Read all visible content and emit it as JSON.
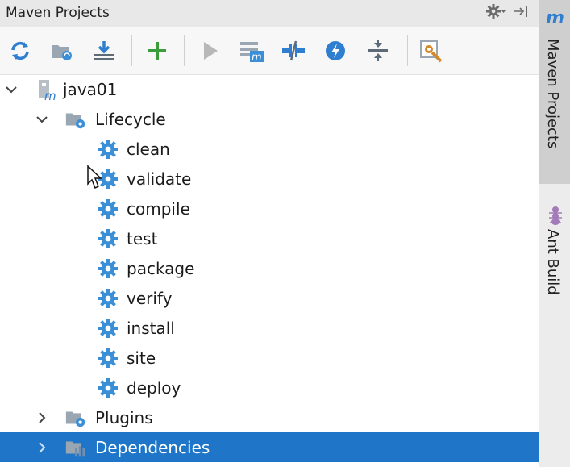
{
  "window": {
    "title": "Maven Projects"
  },
  "toolbar": {
    "items": [
      {
        "name": "reimport-icon"
      },
      {
        "name": "generate-sources-icon"
      },
      {
        "name": "download-icon"
      },
      {
        "name": "add-icon"
      },
      {
        "name": "run-icon"
      },
      {
        "name": "execute-goal-icon"
      },
      {
        "name": "toggle-offline-icon"
      },
      {
        "name": "skip-tests-icon"
      },
      {
        "name": "collapse-all-icon"
      },
      {
        "name": "settings-icon"
      }
    ]
  },
  "tree": {
    "project": "java01",
    "lifecycle": {
      "label": "Lifecycle",
      "goals": [
        "clean",
        "validate",
        "compile",
        "test",
        "package",
        "verify",
        "install",
        "site",
        "deploy"
      ]
    },
    "plugins": "Plugins",
    "dependencies": "Dependencies"
  },
  "sidebar": {
    "m_glyph": "m",
    "maven_tab": "Maven Projects",
    "ant_tab": "Ant Build"
  },
  "colors": {
    "selection": "#1f76c8",
    "gear": "#3b8fd6",
    "add": "#3a9d3a"
  }
}
